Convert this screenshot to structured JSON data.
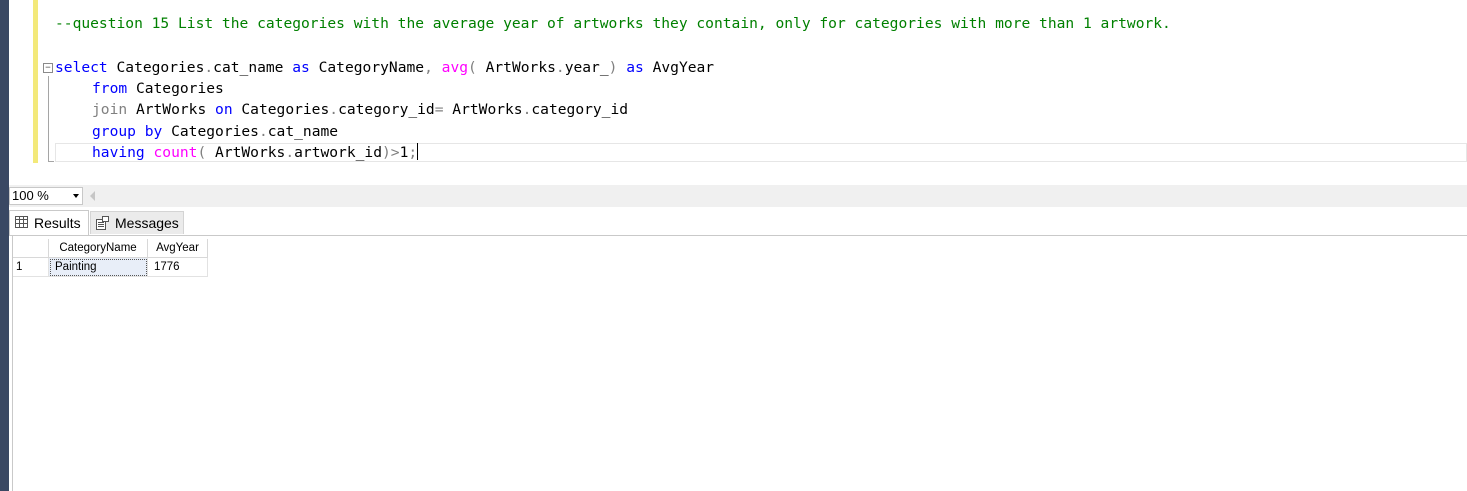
{
  "editor": {
    "comment_line": "--question 15 List the categories with the average year of artworks they contain, only for categories with more than 1 artwork.",
    "collapse_symbol": "−",
    "line1": {
      "kw_select": "select",
      "t1": " Categories",
      "p1": ".",
      "t2": "cat_name ",
      "kw_as": "as",
      "t3": " CategoryName",
      "p2": ",",
      "sp1": " ",
      "fn_avg": "avg",
      "p3": "(",
      "t4": " ArtWorks",
      "p4": ".",
      "t5": "year_",
      "p5": ")",
      "sp2": " ",
      "kw_as2": "as",
      "t6": " AvgYear"
    },
    "line2": {
      "kw_from": "from",
      "t1": " Categories"
    },
    "line3": {
      "kw_join": "join",
      "t1": " ArtWorks ",
      "kw_on": "on",
      "t2": " Categories",
      "p1": ".",
      "t3": "category_id",
      "p2": "=",
      "t4": " ArtWorks",
      "p3": ".",
      "t5": "category_id"
    },
    "line4": {
      "kw_group": "group",
      "sp": " ",
      "kw_by": "by",
      "t1": " Categories",
      "p1": ".",
      "t2": "cat_name"
    },
    "line5": {
      "kw_having": "having",
      "sp": " ",
      "fn_count": "count",
      "p1": "(",
      "t1": " ArtWorks",
      "p2": ".",
      "t2": "artwork_id",
      "p3": ")>",
      "t3": "1",
      "p4": ";"
    }
  },
  "zoom": {
    "value": "100 %"
  },
  "tabs": {
    "results_label": "Results",
    "messages_label": "Messages"
  },
  "results": {
    "columns": [
      "CategoryName",
      "AvgYear"
    ],
    "rows": [
      {
        "row_number": "1",
        "CategoryName": "Painting",
        "AvgYear": "1776"
      }
    ]
  },
  "colors": {
    "keyword": "#0000ff",
    "comment": "#008000",
    "function": "#ff00ff",
    "operator": "#808080",
    "frame": "#3a4863"
  }
}
